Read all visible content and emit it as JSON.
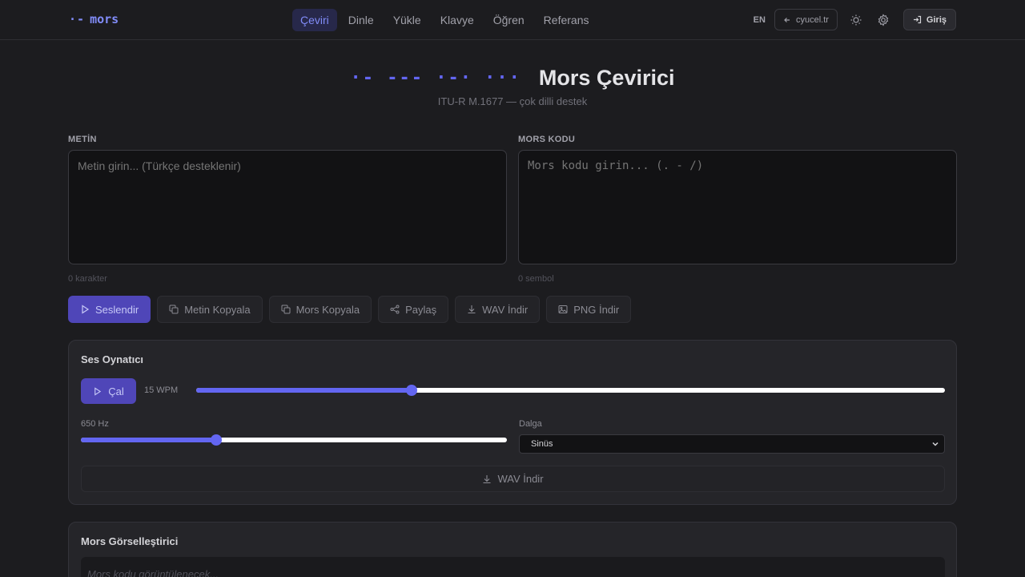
{
  "nav": {
    "logo_dots": "·-",
    "logo_text": "mors",
    "links": [
      "Çeviri",
      "Dinle",
      "Yükle",
      "Klavye",
      "Öğren",
      "Referans"
    ],
    "active_link": "Çeviri",
    "lang": "EN",
    "back_label": "cyucel.tr",
    "login_label": "Giriş"
  },
  "hero": {
    "morse": "·-  ---  ·-·  ···",
    "title": "Mors Çevirici",
    "subtitle": "ITU-R M.1677 — çok dilli destek"
  },
  "text_panel": {
    "label": "METİN",
    "placeholder": "Metin girin... (Türkçe desteklenir)",
    "counter": "0 karakter"
  },
  "morse_panel": {
    "label": "MORS KODU",
    "placeholder": "Mors kodu girin... (. - /)",
    "counter": "0 sembol"
  },
  "actions": {
    "speak": "Seslendir",
    "copy_text": "Metin Kopyala",
    "copy_morse": "Mors Kopyala",
    "share": "Paylaş",
    "wav": "WAV İndir",
    "png": "PNG İndir"
  },
  "player": {
    "title": "Ses Oynatıcı",
    "play_label": "Çal",
    "wpm_label": "15 WPM",
    "wpm_fraction": 0.288,
    "hz_label": "650 Hz",
    "hz_fraction": 0.318,
    "wave_label": "Dalga",
    "wave_value": "Sinüs",
    "wav_label": "WAV İndir"
  },
  "visualizer": {
    "title": "Mors Görselleştirici",
    "placeholder": "Mors kodu görüntülenecek..."
  }
}
